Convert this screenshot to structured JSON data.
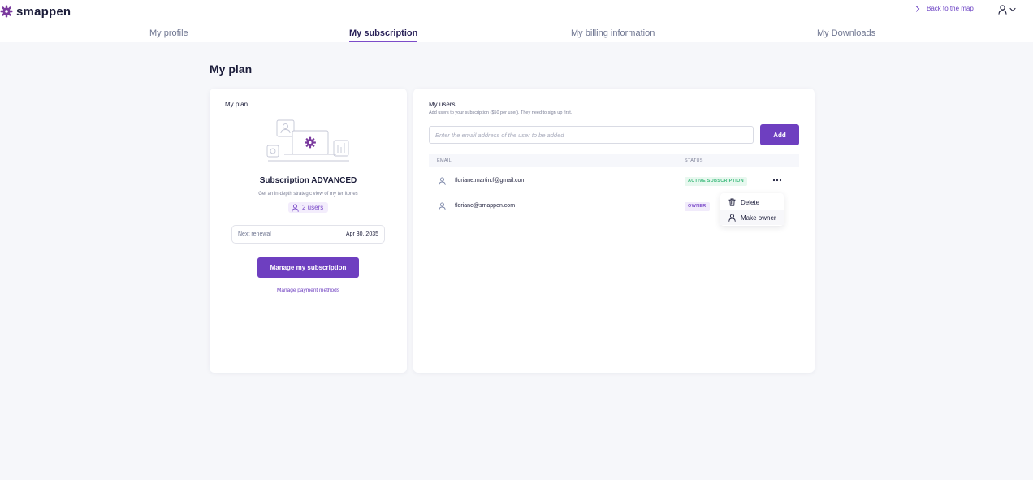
{
  "app": {
    "name": "smappen"
  },
  "header": {
    "back_link": "Back to the map",
    "icons": {
      "back": "chevron-right-icon",
      "user": "user-icon",
      "menu": "chevron-down-icon"
    }
  },
  "tabs": [
    {
      "label": "My profile",
      "active": false
    },
    {
      "label": "My subscription",
      "active": true
    },
    {
      "label": "My billing information",
      "active": false
    },
    {
      "label": "My Downloads",
      "active": false
    }
  ],
  "page": {
    "title": "My plan"
  },
  "plan_card": {
    "label": "My plan",
    "plan_name": "Subscription ADVANCED",
    "description": "Get an in-depth strategic view of my territories",
    "users_badge": "2 users",
    "renewal_label": "Next renewal",
    "renewal_date": "Apr 30, 2035",
    "manage_button": "Manage my subscription",
    "payment_link": "Manage payment methods"
  },
  "users_card": {
    "label": "My users",
    "subtitle": "Add users to your subscription ($50 per user). They need to sign up first.",
    "email_placeholder": "Enter the email address of the user to be added",
    "email_value": "",
    "add_button": "Add",
    "columns": {
      "email": "EMAIL",
      "status": "STATUS"
    },
    "rows": [
      {
        "email": "floriane.martin.f@gmail.com",
        "status": "ACTIVE SUBSCRIPTION"
      },
      {
        "email": "floriane@smappen.com",
        "status": "OWNER"
      }
    ],
    "menu": {
      "delete": "Delete",
      "make_owner": "Make owner"
    }
  },
  "colors": {
    "accent": "#6e3fc0",
    "active_status_bg": "#e8f8ef",
    "active_status_text": "#3ab97a",
    "owner_status_bg": "#f1ebfb",
    "owner_status_text": "#7c4cc9"
  }
}
